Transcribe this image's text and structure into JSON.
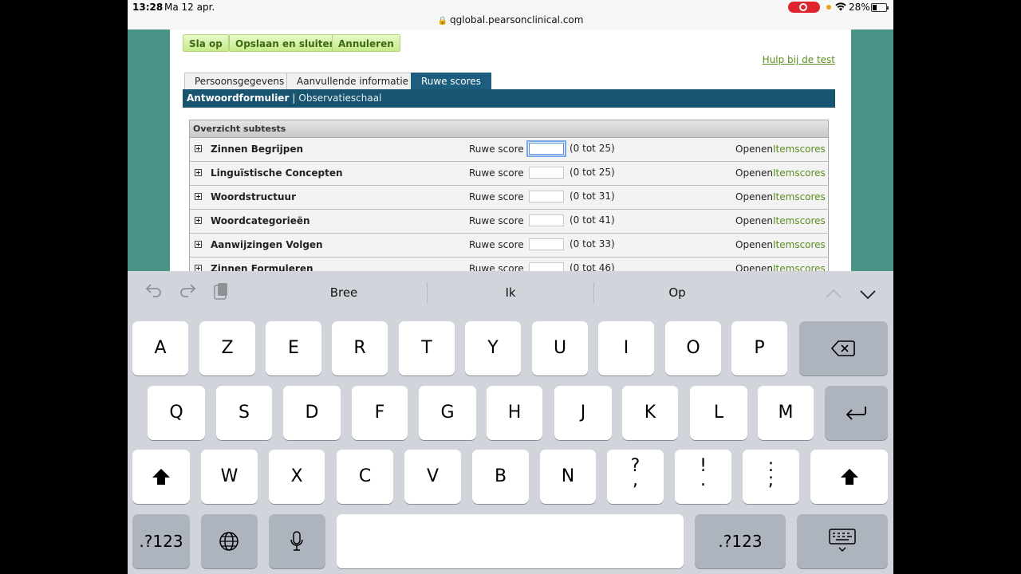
{
  "status_bar": {
    "time": "13:28",
    "date": "Ma 12 apr.",
    "url": "qglobal.pearsonclinical.com",
    "battery": "28%"
  },
  "toolbar": {
    "save": "Sla op",
    "save_close": "Opslaan en sluiten",
    "cancel": "Annuleren",
    "help": "Hulp bij de test"
  },
  "tabs": [
    "Persoonsgegevens",
    "Aanvullende informatie",
    "Ruwe scores"
  ],
  "subtabs": {
    "primary": "Antwoordformulier",
    "separator": "|",
    "secondary": "Observatieschaal"
  },
  "overview": {
    "title": "Overzicht subtests",
    "score_label": "Ruwe score",
    "open_label": "Openen",
    "items_label": "Itemscores",
    "rows": [
      {
        "name": "Zinnen Begrijpen",
        "value": "",
        "range": "(0 tot 25)"
      },
      {
        "name": "Linguïstische Concepten",
        "value": "",
        "range": "(0 tot 25)"
      },
      {
        "name": "Woordstructuur",
        "value": "",
        "range": "(0 tot 31)"
      },
      {
        "name": "Woordcategorieën",
        "value": "",
        "range": "(0 tot 41)"
      },
      {
        "name": "Aanwijzingen Volgen",
        "value": "",
        "range": "(0 tot 33)"
      },
      {
        "name": "Zinnen Formuleren",
        "value": "",
        "range": "(0 tot 46)"
      }
    ]
  },
  "keyboard": {
    "suggestions": [
      "Bree",
      "Ik",
      "Op"
    ],
    "row1": [
      "A",
      "Z",
      "E",
      "R",
      "T",
      "Y",
      "U",
      "I",
      "O",
      "P"
    ],
    "row2": [
      "Q",
      "S",
      "D",
      "F",
      "G",
      "H",
      "J",
      "K",
      "L",
      "M"
    ],
    "row3": [
      "W",
      "X",
      "C",
      "V",
      "B",
      "N"
    ],
    "punct": [
      {
        "top": "?",
        "bottom": ","
      },
      {
        "top": "!",
        "bottom": "."
      },
      {
        "top": ":",
        "bottom": ";"
      }
    ],
    "numbers_label": ".?123"
  }
}
